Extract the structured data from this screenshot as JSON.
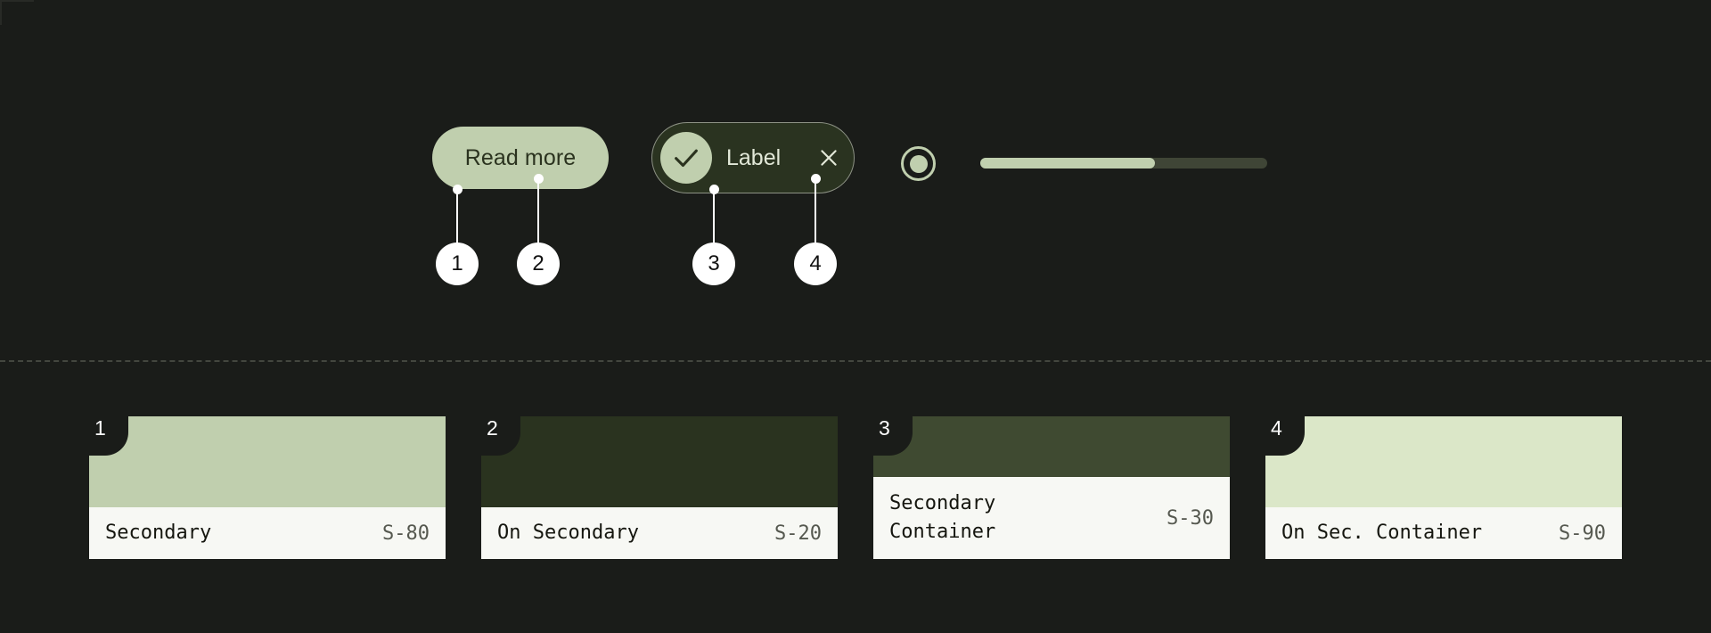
{
  "theme": {
    "background": "#1a1c19",
    "accent": "#c0cfae",
    "on_accent": "#2b331f",
    "chip_surface": "#2a3320",
    "chip_outline": "#8d9285",
    "chip_text": "#e2e8d8",
    "slider_track": "#3f4536",
    "divider": "#43463f",
    "callout_bg": "#ffffff",
    "callout_text": "#111111",
    "card_label_bg": "#f7f8f4",
    "card_label_text": "#15160f",
    "card_tone_text": "#55584f"
  },
  "components": {
    "button": {
      "label": "Read more",
      "icon": "none"
    },
    "chip": {
      "label": "Label",
      "leading_icon": "check-icon",
      "trailing_icon": "close-icon"
    },
    "radio": {
      "icon": "radio-selected-icon",
      "selected": true
    },
    "slider": {
      "icon": "slider-track",
      "value_percent": 61
    }
  },
  "callouts": [
    {
      "number": "1",
      "stem_height": 60
    },
    {
      "number": "2",
      "stem_height": 72
    },
    {
      "number": "3",
      "stem_height": 60
    },
    {
      "number": "4",
      "stem_height": 72
    }
  ],
  "cards": [
    {
      "number": "1",
      "name": "Secondary",
      "tone": "S-80",
      "color": "#c0cfae",
      "lines": 1
    },
    {
      "number": "2",
      "name": "On Secondary",
      "tone": "S-20",
      "color": "#2a331f",
      "lines": 1
    },
    {
      "number": "3",
      "name": "Secondary\nContainer",
      "tone": "S-30",
      "color": "#3f4a31",
      "lines": 2
    },
    {
      "number": "4",
      "name": "On Sec. Container",
      "tone": "S-90",
      "color": "#dbe7c8",
      "lines": 1
    }
  ]
}
